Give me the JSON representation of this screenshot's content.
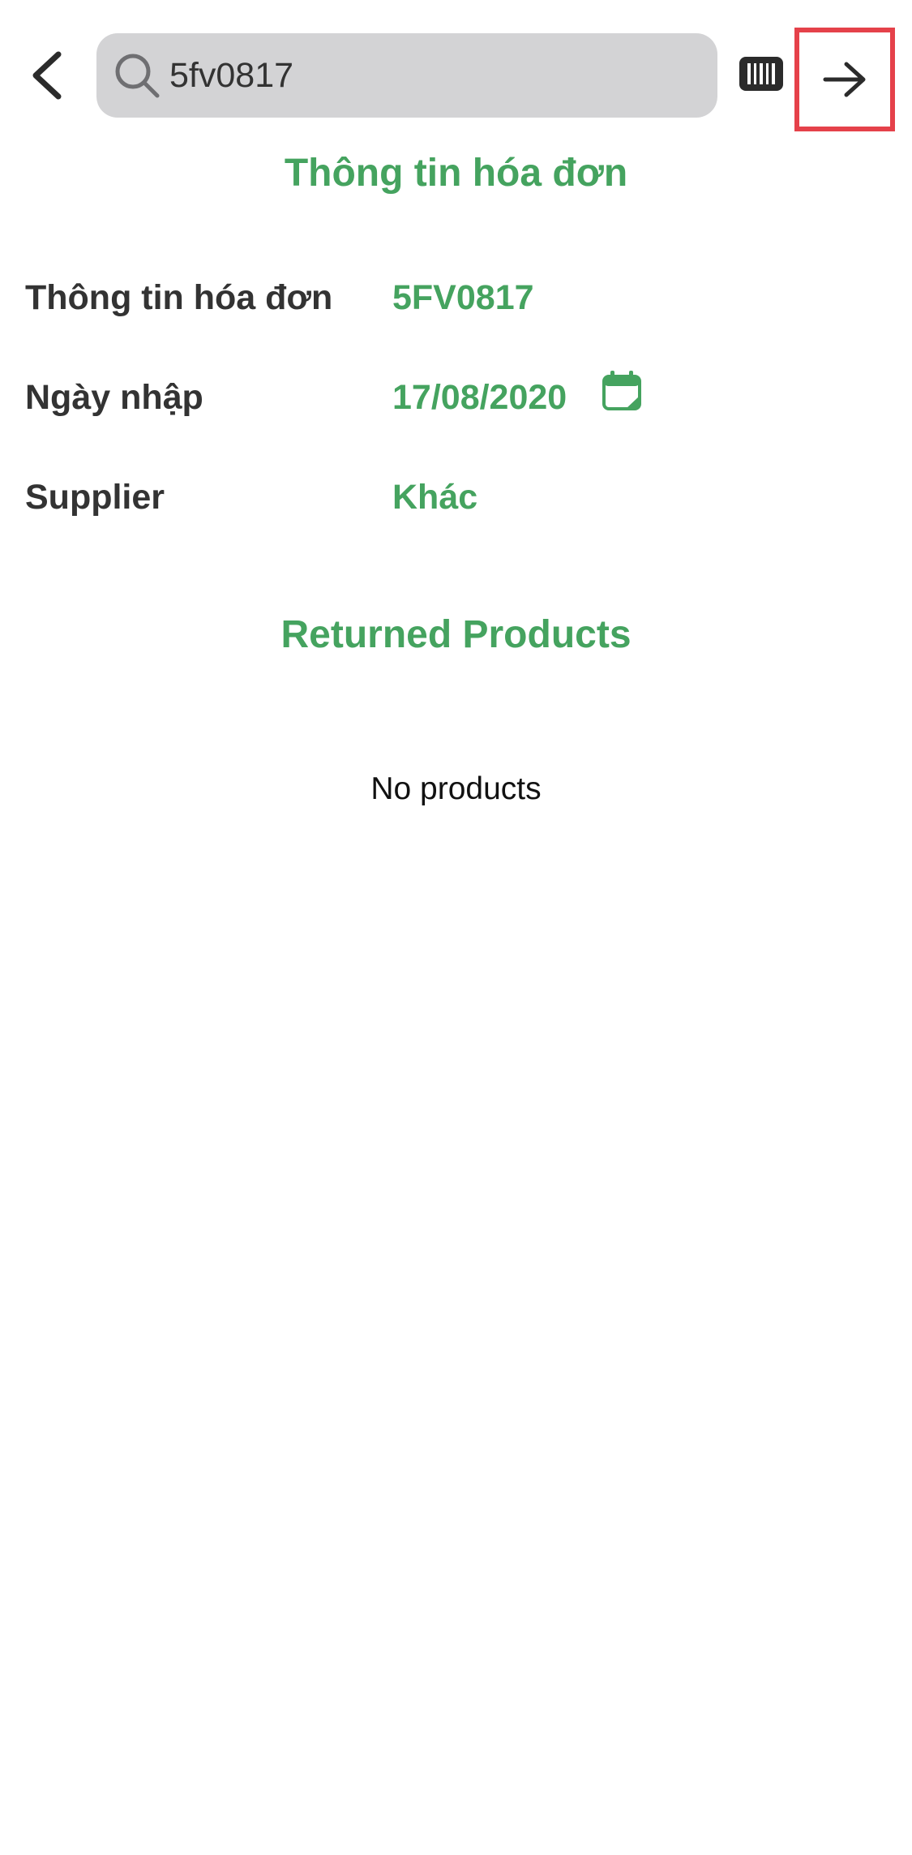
{
  "header": {
    "search": {
      "value": "5fv0817",
      "placeholder": ""
    },
    "icons": {
      "back": "chevron-left-icon",
      "search": "search-icon",
      "barcode": "barcode-icon",
      "next": "arrow-right-icon"
    }
  },
  "invoice_section": {
    "title": "Thông tin hóa đơn",
    "rows": [
      {
        "label": "Thông tin hóa đơn",
        "value": "5FV0817"
      },
      {
        "label": "Ngày nhập",
        "value": "17/08/2020"
      },
      {
        "label": "Supplier",
        "value": "Khác"
      }
    ]
  },
  "returned_section": {
    "title": "Returned Products",
    "empty_text": "No products"
  },
  "colors": {
    "accent_green": "#45a35f",
    "highlight_red": "#e5414a",
    "search_bg": "#d3d3d5",
    "label_text": "#333333"
  }
}
